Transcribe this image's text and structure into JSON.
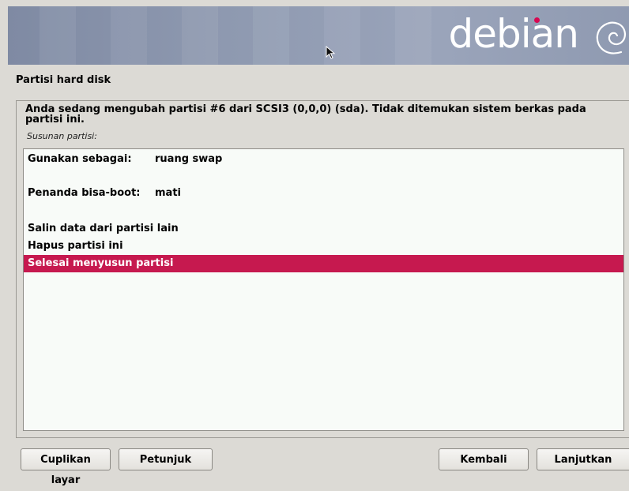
{
  "banner": {
    "logo_text": "debian"
  },
  "section_title": "Partisi hard disk",
  "question": "Anda sedang mengubah partisi #6 dari SCSI3 (0,0,0) (sda). Tidak ditemukan sistem berkas pada partisi ini.",
  "subtitle": "Susunan partisi:",
  "list": {
    "items": [
      {
        "label": "Gunakan sebagai:",
        "value": "ruang swap"
      },
      {
        "label": "Penanda bisa-boot:",
        "value": "mati"
      },
      {
        "label": "Salin data dari partisi lain"
      },
      {
        "label": "Hapus partisi ini"
      },
      {
        "label": "Selesai menyusun partisi",
        "selected": true
      }
    ]
  },
  "buttons": {
    "screenshot": "Cuplikan layar",
    "help": "Petunjuk",
    "back": "Kembali",
    "continue": "Lanjutkan"
  },
  "colors": {
    "selection": "#c6194f",
    "banner": "#8e99b0",
    "background": "#dcdad5"
  }
}
